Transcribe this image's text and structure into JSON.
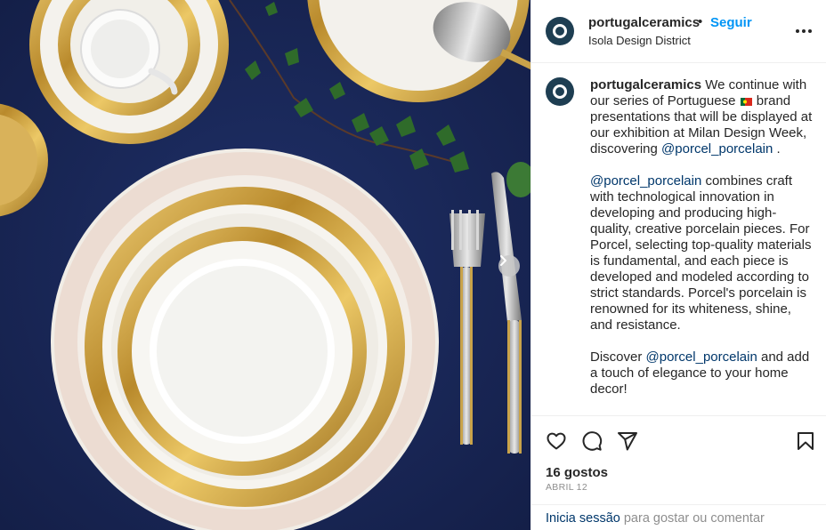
{
  "post": {
    "image_alt": "Gold-rimmed Porcel porcelain dinnerware on navy tablecloth",
    "next_icon": "chevron-right-icon"
  },
  "header": {
    "username": "portugalceramics",
    "separator": "•",
    "follow_label": "Seguir",
    "location": "Isola Design District",
    "more_icon": "more-horizontal-icon"
  },
  "caption": {
    "username": "portugalceramics",
    "p1_before_flag": " We continue with our series of Portuguese ",
    "p1_after_flag": " brand presentations that will be displayed at our exhibition at Milan Design Week, discovering ",
    "p1_mention": "@porcel_porcelain",
    "p1_end": " .",
    "p2_mention": "@porcel_porcelain",
    "p2_text": " combines craft with technological innovation in developing and producing high-quality, creative porcelain pieces. For Porcel, selecting top-quality materials is fundamental, and each piece is developed and modeled according to strict standards. Porcel's porcelain is renowned for its whiteness, shine, and resistance.",
    "p3_before": "Discover ",
    "p3_mention": "@porcel_porcelain",
    "p3_after": " and add a touch of elegance to your home decor!"
  },
  "actions": {
    "like_icon": "heart-icon",
    "comment_icon": "comment-icon",
    "share_icon": "send-icon",
    "save_icon": "bookmark-icon"
  },
  "likes": "16 gostos",
  "date": "ABRIL 12",
  "footer": {
    "login_label": "Inicia sessão",
    "rest_text": " para gostar ou comentar"
  },
  "colors": {
    "brand_blue": "#0095f6",
    "link_blue": "#00376b",
    "tablecloth": "#1a2a5c",
    "gold": "#c9a34a"
  }
}
